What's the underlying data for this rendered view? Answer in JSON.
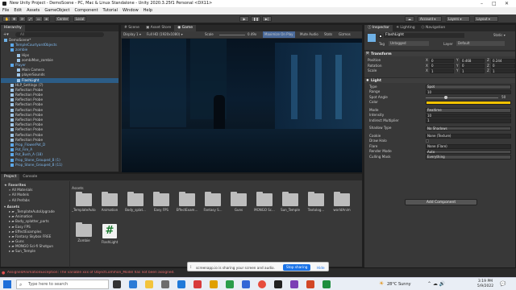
{
  "window": {
    "title": "New Unity Project - DemoScene - PC, Mac & Linux Standalone - Unity 2020.3.25f1 Personal <DX11>",
    "min": "–",
    "max": "□",
    "close": "✕"
  },
  "menu": [
    "File",
    "Edit",
    "Assets",
    "GameObject",
    "Component",
    "Tutorial",
    "Window",
    "Help"
  ],
  "toolbar": {
    "pivot": "Center",
    "space": "Local",
    "account": "Account",
    "layers": "Layers",
    "layout": "Layout"
  },
  "hierarchy": {
    "tab": "Hierarchy",
    "search_placeholder": "All",
    "items": [
      {
        "label": "DemoScene*",
        "indent": 1,
        "kind": "scene"
      },
      {
        "label": "TempleCourtyardObjects",
        "indent": 2,
        "kind": "blue"
      },
      {
        "label": "zombie",
        "indent": 2,
        "kind": "blue"
      },
      {
        "label": "Hips",
        "indent": 3,
        "kind": "plain"
      },
      {
        "label": "zombiMan_zombie",
        "indent": 3,
        "kind": "plain"
      },
      {
        "label": "Player",
        "indent": 2,
        "kind": "blue"
      },
      {
        "label": "Main Camera",
        "indent": 3,
        "kind": "plain"
      },
      {
        "label": "playerSounds",
        "indent": 3,
        "kind": "plain"
      },
      {
        "label": "FlashLight",
        "indent": 3,
        "kind": "plain",
        "selected": true
      },
      {
        "label": "HLP_Settings (7)",
        "indent": 2,
        "kind": "plain"
      },
      {
        "label": "Reflection Probe",
        "indent": 2,
        "kind": "plain"
      },
      {
        "label": "Reflection Probe",
        "indent": 2,
        "kind": "plain"
      },
      {
        "label": "Reflection Probe",
        "indent": 2,
        "kind": "plain"
      },
      {
        "label": "Reflection Probe",
        "indent": 2,
        "kind": "plain"
      },
      {
        "label": "Reflection Probe",
        "indent": 2,
        "kind": "plain"
      },
      {
        "label": "Reflection Probe",
        "indent": 2,
        "kind": "plain"
      },
      {
        "label": "Reflection Probe",
        "indent": 2,
        "kind": "plain"
      },
      {
        "label": "Reflection Probe",
        "indent": 2,
        "kind": "plain"
      },
      {
        "label": "Reflection Probe",
        "indent": 2,
        "kind": "plain"
      },
      {
        "label": "Reflection Probe",
        "indent": 2,
        "kind": "plain"
      },
      {
        "label": "Reflection Probe",
        "indent": 2,
        "kind": "plain"
      },
      {
        "label": "Prop_FlowerPot_D",
        "indent": 2,
        "kind": "blue"
      },
      {
        "label": "Pot_Fire_A",
        "indent": 2,
        "kind": "blue"
      },
      {
        "label": "Pot_Bush_A (18)",
        "indent": 2,
        "kind": "blue"
      },
      {
        "label": "Prop_Stone_Grouped_B (1)",
        "indent": 2,
        "kind": "blue"
      },
      {
        "label": "Prop_Stone_Grouped_B (11)",
        "indent": 2,
        "kind": "blue"
      }
    ]
  },
  "scene_tabs": [
    "Scene",
    "Asset Store",
    "Game"
  ],
  "game_toolbar": {
    "display": "Display 1",
    "resolution": "Full HD (1920x1080)",
    "scale_label": "Scale",
    "scale_value": "0.49x",
    "buttons": [
      "Maximize On Play",
      "Mute Audio",
      "Stats",
      "Gizmos"
    ]
  },
  "inspector": {
    "tabs": [
      "Inspector",
      "Lighting",
      "Navigation"
    ],
    "object_name": "FlashLight",
    "static_label": "Static",
    "tag_label": "Tag",
    "tag_value": "Untagged",
    "layer_label": "Layer",
    "layer_value": "Default",
    "transform": {
      "title": "Transform",
      "rows": [
        {
          "label": "Position",
          "x": "0",
          "y": "0.468",
          "z": "0.244"
        },
        {
          "label": "Rotation",
          "x": "0",
          "y": "0",
          "z": "0"
        },
        {
          "label": "Scale",
          "x": "1",
          "y": "1",
          "z": "1"
        }
      ]
    },
    "light": {
      "title": "Light",
      "rows": [
        {
          "label": "Type",
          "value": "Spot"
        },
        {
          "label": "Range",
          "value": "10"
        },
        {
          "label": "Spot Angle",
          "value": "50"
        },
        {
          "label": "Color",
          "value": ""
        },
        {
          "label": "Mode",
          "value": "Realtime"
        },
        {
          "label": "Intensity",
          "value": "10"
        },
        {
          "label": "Indirect Multiplier",
          "value": "1"
        },
        {
          "label": "Shadow Type",
          "value": "No Shadows"
        },
        {
          "label": "Cookie",
          "value": "None (Texture)"
        },
        {
          "label": "Draw Halo",
          "value": ""
        },
        {
          "label": "Flare",
          "value": "None (Flare)"
        },
        {
          "label": "Render Mode",
          "value": "Auto"
        },
        {
          "label": "Culling Mask",
          "value": "Everything"
        }
      ],
      "color_hex": "#f2c200"
    },
    "add_component": "Add Component"
  },
  "project": {
    "tabs": [
      "Project",
      "Console"
    ],
    "favorites_label": "Favorites",
    "favorites": [
      "All Materials",
      "All Models",
      "All Prefabs"
    ],
    "assets_label": "Assets",
    "asset_tree": [
      "_TemplateAutoUpgrade",
      "Animation",
      "Body_splatter_parts",
      "Easy FPS",
      "EffectExamples",
      "Fantasy Skybox FREE",
      "Guns",
      "MONGO Sci-fi Shotgun",
      "Sun_Temple"
    ],
    "grid_header": "Assets",
    "assets": [
      {
        "label": "_TemplateAuto...",
        "kind": "folder"
      },
      {
        "label": "Animation",
        "kind": "folder"
      },
      {
        "label": "Body_splat...",
        "kind": "folder"
      },
      {
        "label": "Easy FPS",
        "kind": "folder"
      },
      {
        "label": "EffectExam...",
        "kind": "folder"
      },
      {
        "label": "Fantasy S...",
        "kind": "folder"
      },
      {
        "label": "Guns",
        "kind": "folder"
      },
      {
        "label": "MONGO Sc...",
        "kind": "folder"
      },
      {
        "label": "Sun_Temple",
        "kind": "folder"
      },
      {
        "label": "Textolog...",
        "kind": "folder"
      },
      {
        "label": "worldAnim",
        "kind": "folder"
      },
      {
        "label": "Zombie",
        "kind": "folder"
      },
      {
        "label": "FlashLight",
        "kind": "script"
      }
    ]
  },
  "status_bar": {
    "error": "AssignedAnimationException: The variable xxx of ObjectCommon_Model has not been assigned."
  },
  "share_notice": {
    "text": "screenapp.io is sharing your screen and audio.",
    "stop": "Stop sharing",
    "hide": "Hide"
  },
  "taskbar": {
    "search_placeholder": "Type here to search",
    "weather": "28°C  Sunny",
    "time": "3:19 PM",
    "date": "5/9/2022"
  }
}
